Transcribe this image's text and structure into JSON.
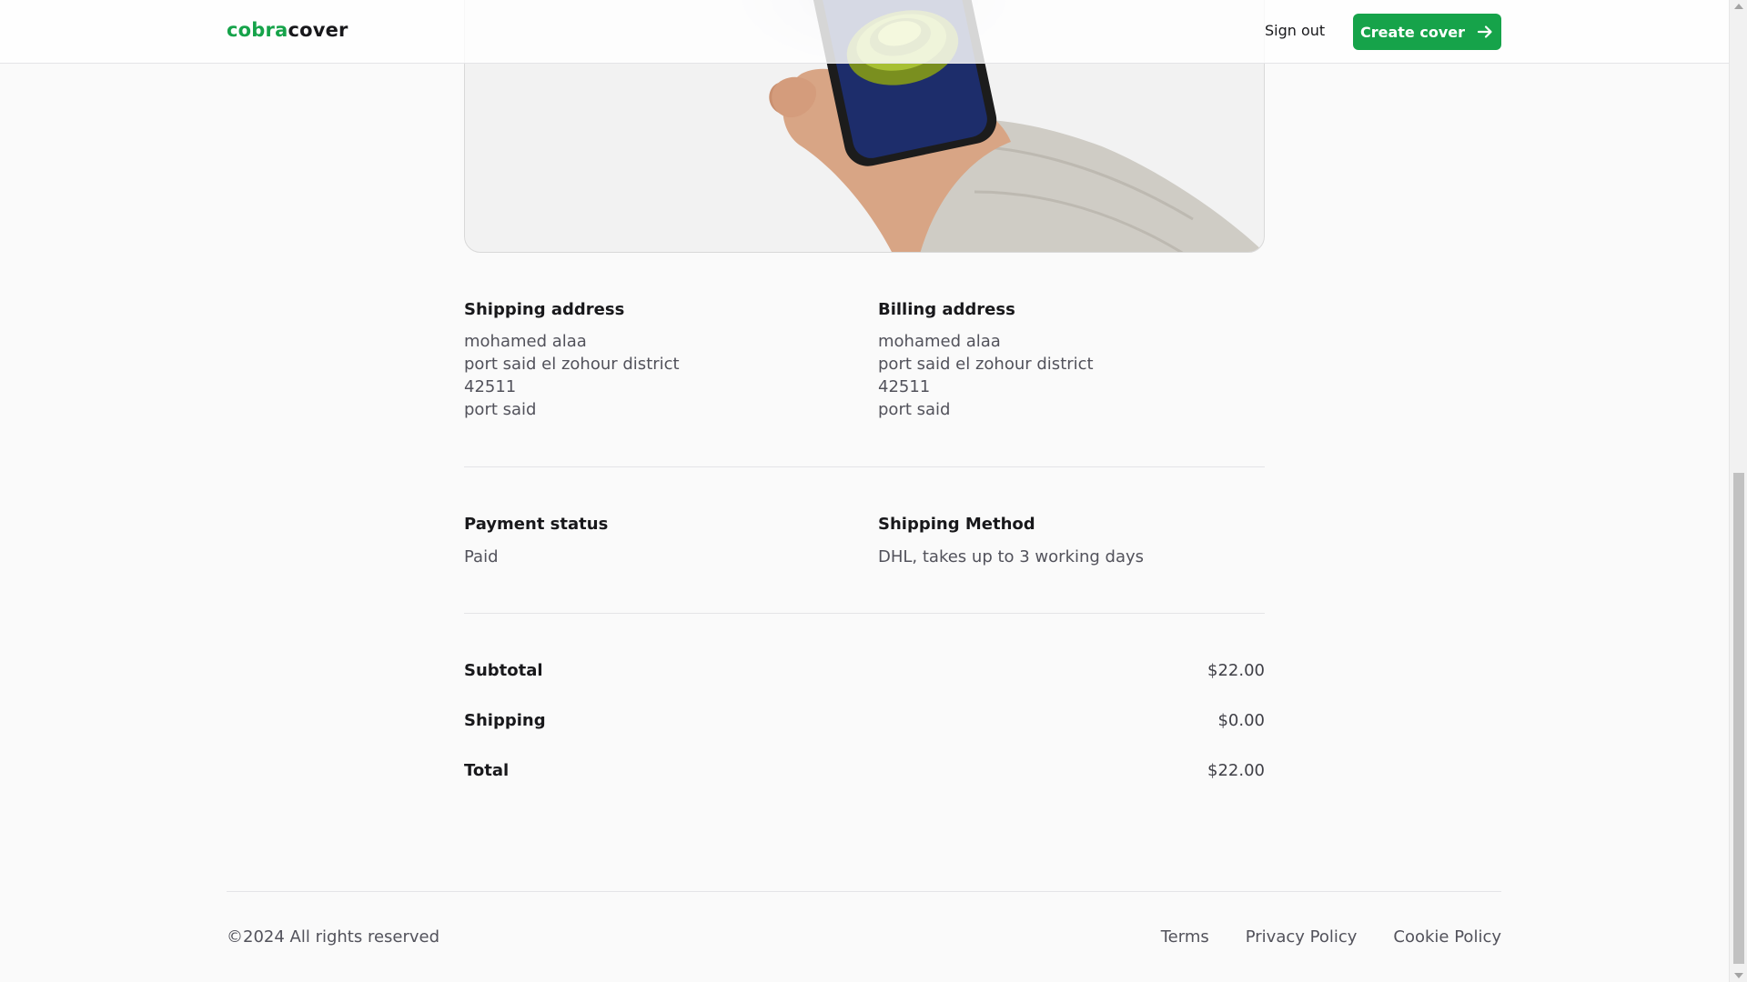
{
  "header": {
    "logo_accent": "cobra",
    "logo_rest": "cover",
    "signout_label": "Sign out",
    "create_label": "Create cover",
    "accent_color": "#16a34a"
  },
  "shipping_address": {
    "title": "Shipping address",
    "name": "mohamed alaa",
    "street": "port said el zohour district",
    "postal_code": "42511",
    "city": "port said"
  },
  "billing_address": {
    "title": "Billing address",
    "name": "mohamed alaa",
    "street": "port said el zohour district",
    "postal_code": "42511",
    "city": "port said"
  },
  "payment": {
    "title": "Payment status",
    "value": "Paid"
  },
  "shipping_method": {
    "title": "Shipping Method",
    "value": "DHL, takes up to 3 working days"
  },
  "summary": {
    "subtotal_label": "Subtotal",
    "subtotal_value": "$22.00",
    "shipping_label": "Shipping",
    "shipping_value": "$0.00",
    "total_label": "Total",
    "total_value": "$22.00"
  },
  "footer": {
    "copyright": "©2024 All rights reserved",
    "links": [
      "Terms",
      "Privacy Policy",
      "Cookie Policy"
    ]
  },
  "icons": {
    "create_arrow": "arrow-right-icon"
  }
}
